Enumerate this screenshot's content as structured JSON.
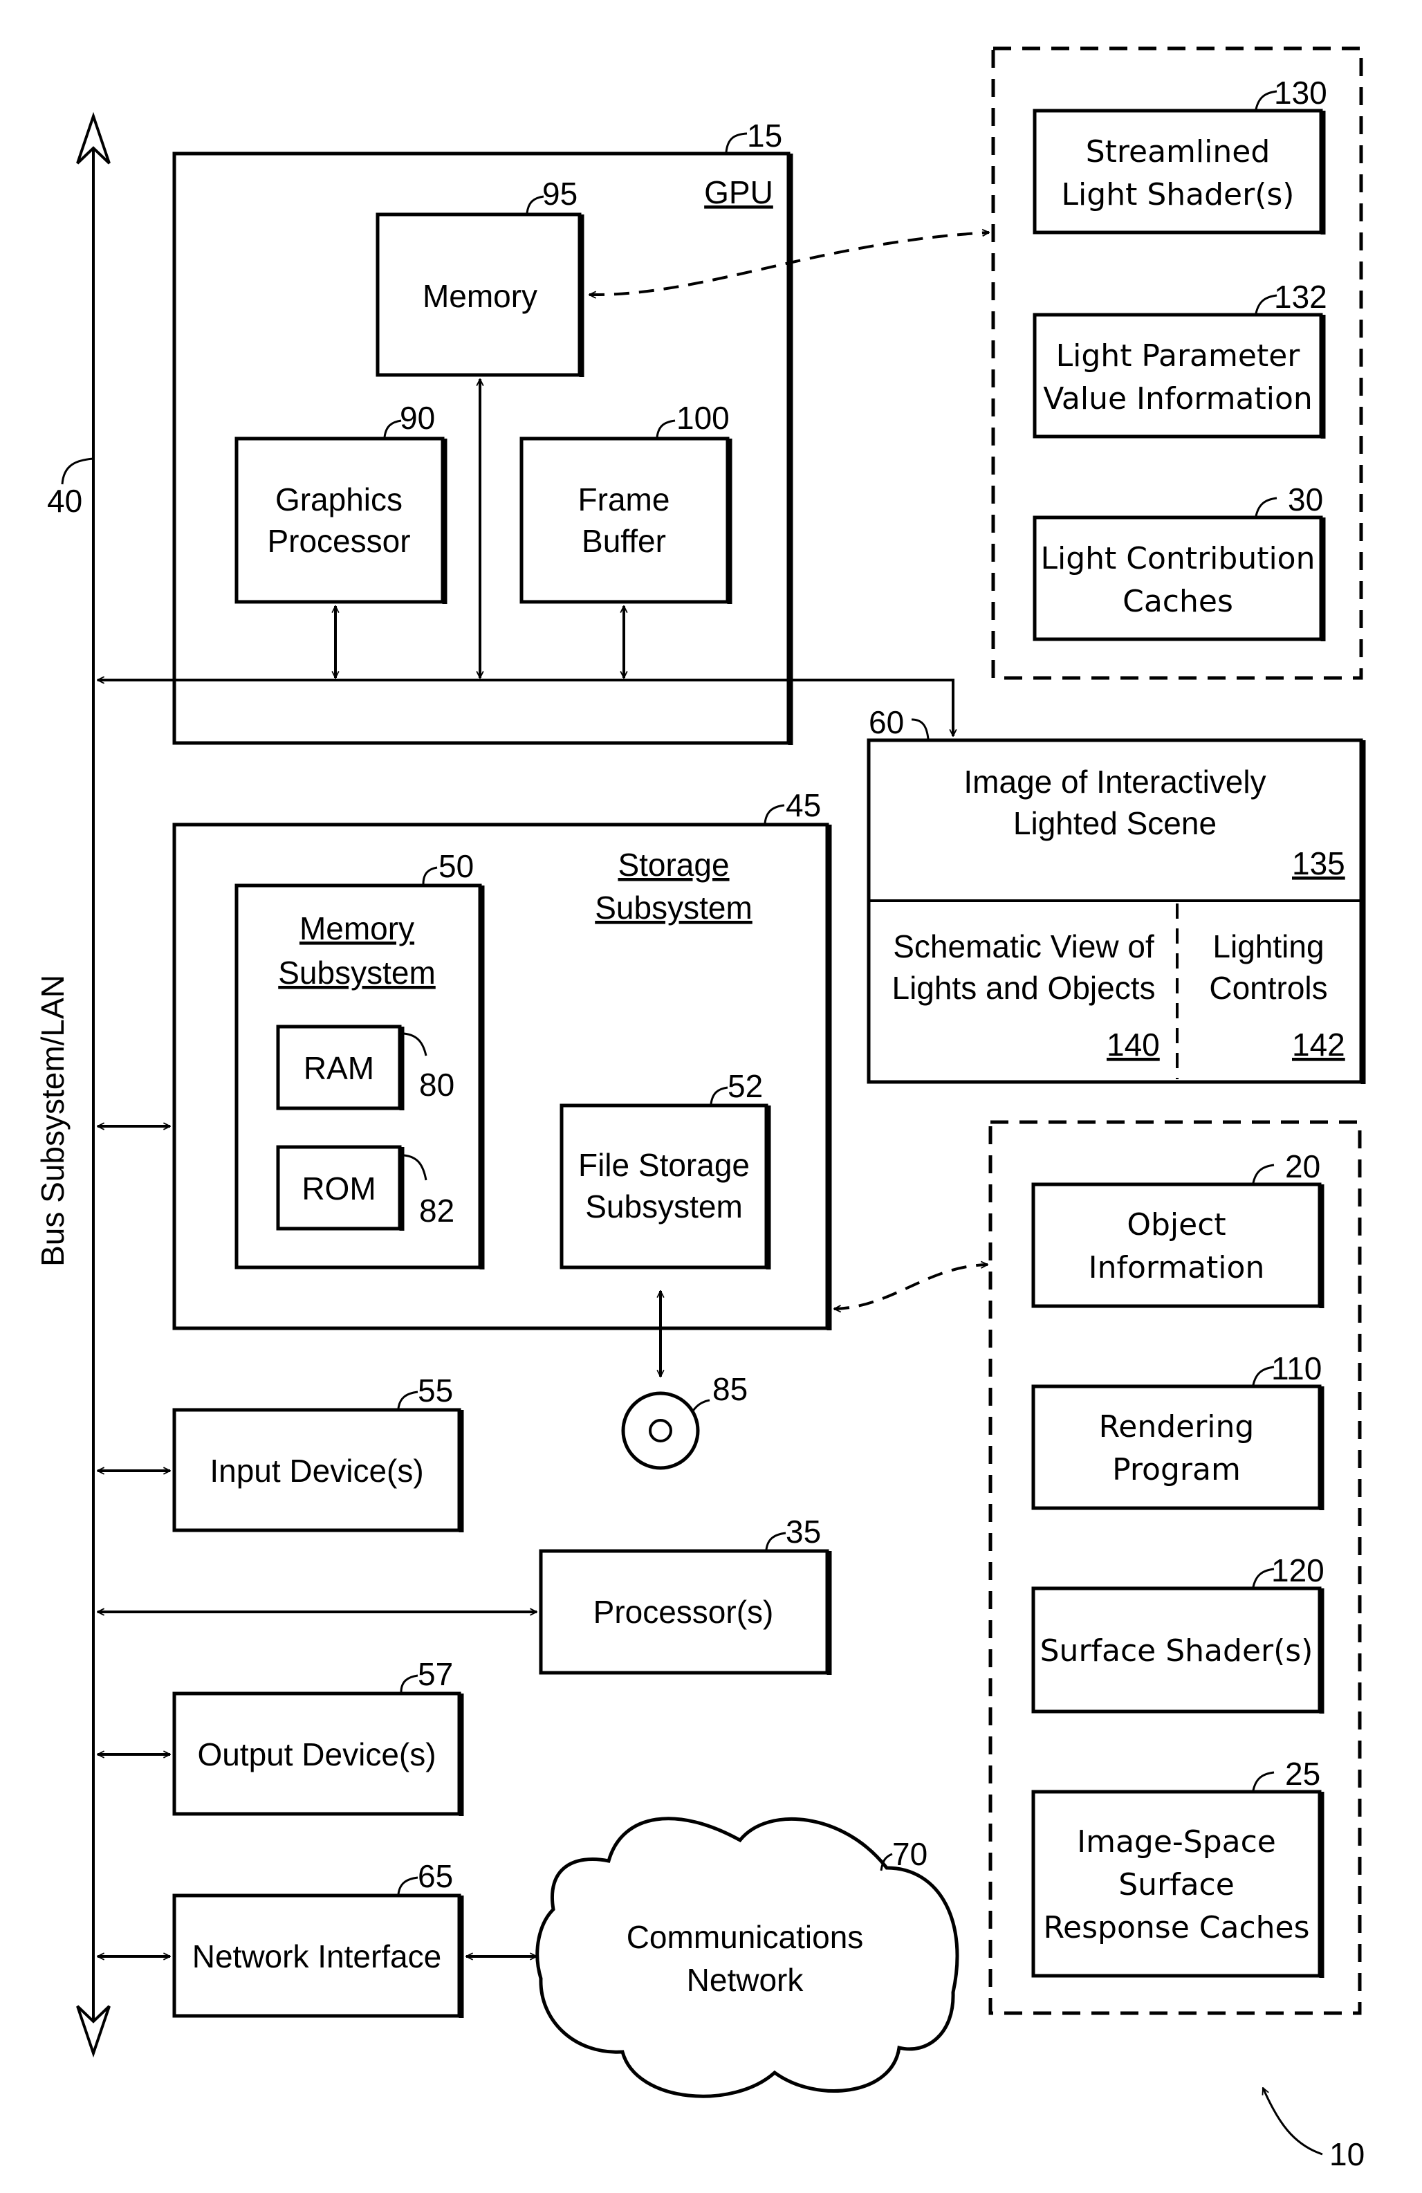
{
  "figure": {
    "system_ref": "10",
    "bus": {
      "label": "Bus Subsystem/LAN",
      "ref": "40"
    },
    "gpu": {
      "ref": "15",
      "title": "GPU",
      "memory": {
        "label": "Memory",
        "ref": "95"
      },
      "graphics_processor": {
        "line1": "Graphics",
        "line2": "Processor",
        "ref": "90"
      },
      "frame_buffer": {
        "line1": "Frame",
        "line2": "Buffer",
        "ref": "100"
      }
    },
    "light_group": {
      "items": [
        {
          "line1": "Streamlined",
          "line2": "Light Shader(s)",
          "ref": "130"
        },
        {
          "line1": "Light Parameter",
          "line2": "Value Information",
          "ref": "132"
        },
        {
          "line1": "Light Contribution",
          "line2": "Caches",
          "ref": "30"
        }
      ]
    },
    "display": {
      "ref": "60",
      "image_panel": {
        "line1": "Image of Interactively",
        "line2": "Lighted Scene",
        "ref": "135"
      },
      "schematic_panel": {
        "line1": "Schematic View of",
        "line2": "Lights and Objects",
        "ref": "140"
      },
      "controls_panel": {
        "line1": "Lighting",
        "line2": "Controls",
        "ref": "142"
      }
    },
    "storage": {
      "ref": "45",
      "title_line1": "Storage",
      "title_line2": "Subsystem",
      "memory_subsystem": {
        "ref": "50",
        "title_line1": "Memory",
        "title_line2": "Subsystem",
        "ram": {
          "label": "RAM",
          "ref": "80"
        },
        "rom": {
          "label": "ROM",
          "ref": "82"
        }
      },
      "file_storage": {
        "line1": "File Storage",
        "line2": "Subsystem",
        "ref": "52"
      },
      "disc": {
        "ref": "85"
      }
    },
    "input_devices": {
      "label": "Input Device(s)",
      "ref": "55"
    },
    "processors": {
      "label": "Processor(s)",
      "ref": "35"
    },
    "output_devices": {
      "label": "Output Device(s)",
      "ref": "57"
    },
    "network_interface": {
      "label": "Network Interface",
      "ref": "65"
    },
    "comm_network": {
      "line1": "Communications",
      "line2": "Network",
      "ref": "70"
    },
    "scene_group": {
      "items": [
        {
          "lines": [
            "Object",
            "Information"
          ],
          "ref": "20"
        },
        {
          "lines": [
            "Rendering",
            "Program"
          ],
          "ref": "110"
        },
        {
          "lines": [
            "Surface Shader(s)"
          ],
          "ref": "120"
        },
        {
          "lines": [
            "Image-Space",
            "Surface",
            "Response Caches"
          ],
          "ref": "25"
        }
      ]
    }
  }
}
